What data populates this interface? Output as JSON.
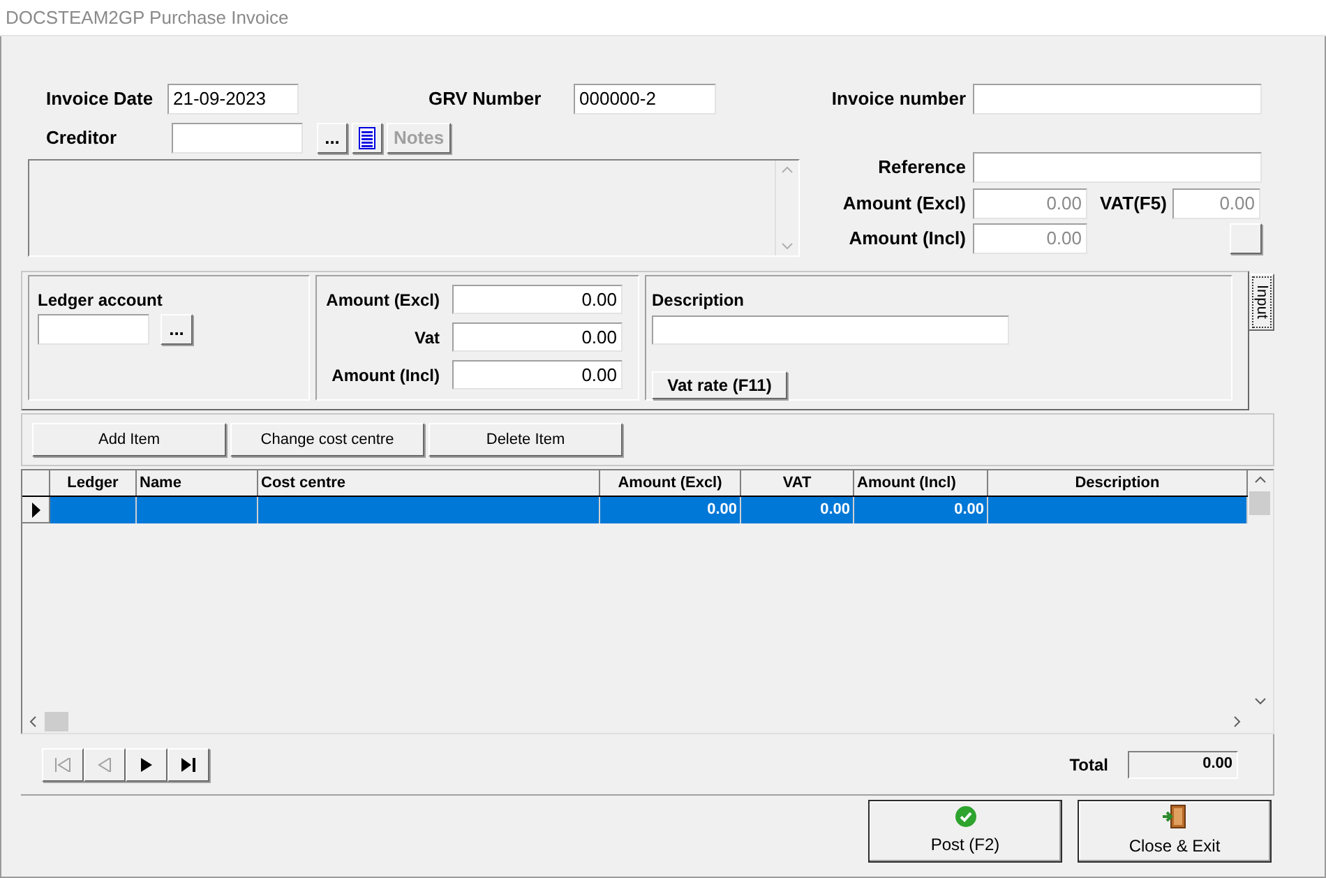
{
  "window": {
    "title": "DOCSTEAM2GP Purchase Invoice"
  },
  "header": {
    "invoice_date": {
      "label": "Invoice Date",
      "value": "21-09-2023"
    },
    "grv_number": {
      "label": "GRV Number",
      "value": "000000-2"
    },
    "invoice_number": {
      "label": "Invoice number"
    },
    "creditor": {
      "label": "Creditor"
    },
    "creditor_buttons": [
      {
        "kind": "browse",
        "label": "...",
        "disabled": false
      },
      {
        "kind": "list",
        "disabled": false
      },
      {
        "kind": "text",
        "label": "Notes",
        "disabled": true
      }
    ],
    "reference": {
      "label": "Reference"
    },
    "amount_excl": {
      "label": "Amount (Excl)",
      "value": "0.00",
      "disabled": true
    },
    "vat": {
      "label": "VAT(F5)",
      "value": "0.00",
      "disabled": true
    },
    "amount_incl": {
      "label": "Amount (Incl)",
      "value": "0.00",
      "disabled": true
    }
  },
  "input_panel": {
    "tab": {
      "label": "Input",
      "selected": true
    },
    "ledger_account": {
      "label": "Ledger account",
      "button": "..."
    },
    "amounts": [
      {
        "label": "Amount (Excl)",
        "value": "0.00"
      },
      {
        "label": "Vat",
        "value": "0.00"
      },
      {
        "label": "Amount (Incl)",
        "value": "0.00"
      }
    ],
    "description": {
      "label": "Description"
    },
    "vat_rate_button": "Vat rate (F11)"
  },
  "toolbar": [
    "Add Item",
    "Change cost centre",
    "Delete Item"
  ],
  "table": {
    "columns": [
      "Ledger",
      "Name",
      "Cost centre",
      "Amount (Excl)",
      "VAT",
      "Amount (Incl)",
      "Description"
    ],
    "rows": [
      {
        "selected": true,
        "current": true,
        "cells": [
          null,
          null,
          null,
          "0.00",
          "0.00",
          "0.00",
          null
        ]
      }
    ]
  },
  "navigator": [
    {
      "kind": "first",
      "disabled": true
    },
    {
      "kind": "prior",
      "disabled": true
    },
    {
      "kind": "next",
      "disabled": false
    },
    {
      "kind": "last",
      "disabled": false
    }
  ],
  "total": {
    "label": "Total",
    "value": "0.00"
  },
  "buttons": [
    {
      "kind": "post",
      "label": "Post (F2)"
    },
    {
      "kind": "exit",
      "label": "Close & Exit"
    }
  ]
}
